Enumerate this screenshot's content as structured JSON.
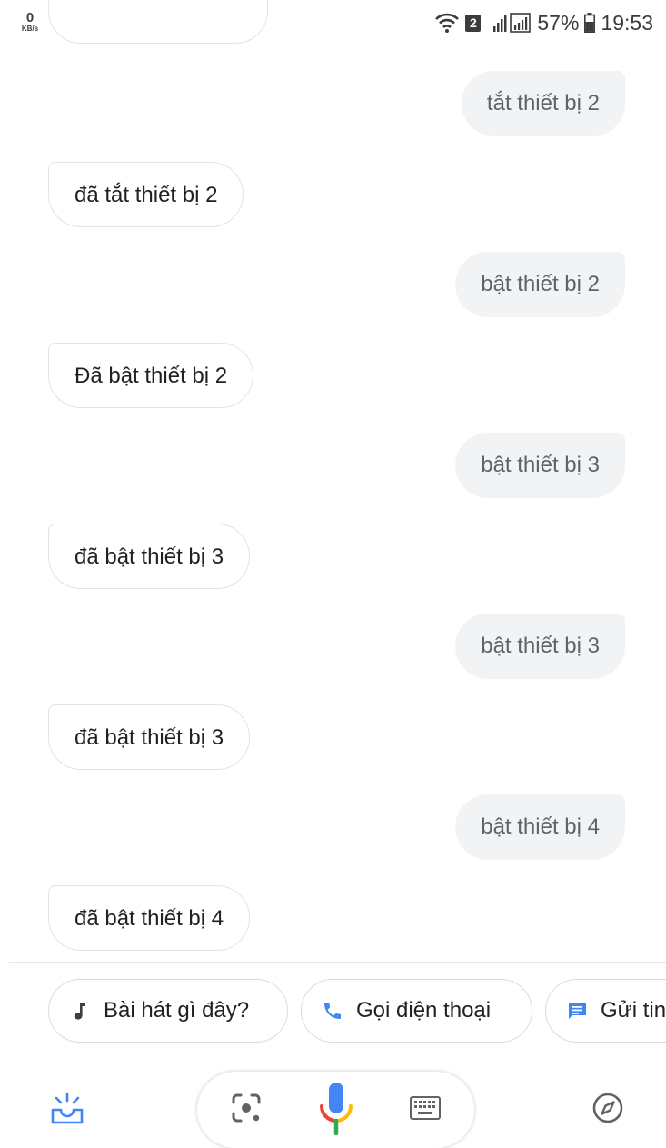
{
  "status_bar": {
    "net_speed_value": "0",
    "net_speed_unit": "KB/s",
    "sim_slot": "2",
    "battery_percent": "57%",
    "time": "19:53"
  },
  "messages": [
    {
      "role": "user",
      "text": "tắt thiết bị 2"
    },
    {
      "role": "assistant",
      "text": "đã tắt thiết bị 2"
    },
    {
      "role": "user",
      "text": "bật thiết bị 2"
    },
    {
      "role": "assistant",
      "text": "Đã bật thiết bị 2"
    },
    {
      "role": "user",
      "text": "bật thiết bị 3"
    },
    {
      "role": "assistant",
      "text": "đã bật thiết bị 3"
    },
    {
      "role": "user",
      "text": "bật thiết bị 3"
    },
    {
      "role": "assistant",
      "text": "đã bật thiết bị 3"
    },
    {
      "role": "user",
      "text": "bật thiết bị 4"
    },
    {
      "role": "assistant",
      "text": "đã bật thiết bị 4"
    }
  ],
  "suggestions": [
    {
      "label": "Bài hát gì đây?",
      "icon": "music-note-icon"
    },
    {
      "label": "Gọi điện thoại",
      "icon": "phone-icon"
    },
    {
      "label": "Gửi tin",
      "icon": "message-icon"
    }
  ],
  "bottom_bar": {
    "left_icon": "updates-inbox-icon",
    "lens_icon": "lens-icon",
    "mic_icon": "microphone-icon",
    "keyboard_icon": "keyboard-icon",
    "right_icon": "explore-compass-icon"
  },
  "colors": {
    "user_bubble_bg": "#f1f3f4",
    "assistant_bubble_border": "#e3e3e3",
    "google_blue": "#4285f4",
    "google_red": "#ea4335",
    "google_yellow": "#fbbc04",
    "google_green": "#34a853",
    "icon_gray": "#5f6368"
  }
}
